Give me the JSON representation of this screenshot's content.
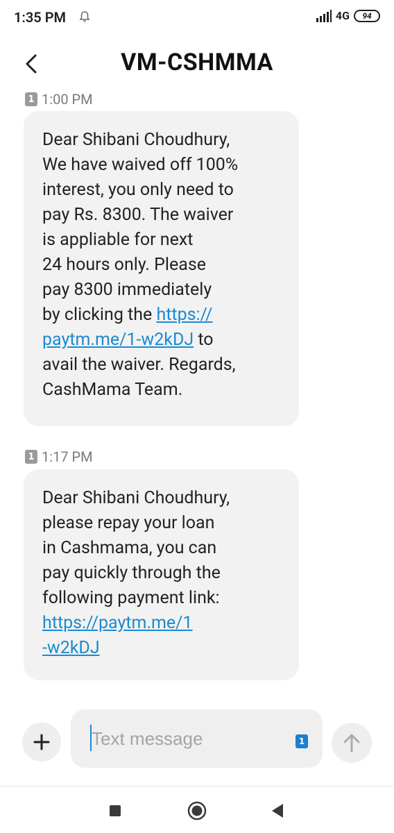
{
  "status_bar": {
    "time": "1:35 PM",
    "network": "4G",
    "battery": "94",
    "icons": [
      "bell-icon",
      "signal-icon",
      "battery-icon"
    ]
  },
  "header": {
    "title": "VM-CSHMMA",
    "back_icon": "chevron-left-icon"
  },
  "messages": [
    {
      "sim": "1",
      "time": "1:00 PM",
      "lines": [
        "Dear Shibani Choudhury,",
        "We have waived off 100%",
        "interest, you only need to",
        "pay Rs. 8300. The waiver",
        "is appliable for next",
        "24 hours only. Please",
        "pay 8300 immediately"
      ],
      "link_line_prefix": "by clicking the ",
      "link_part1": "https://",
      "link_part2": "paytm.me/1-w2kDJ",
      "after_link": " to",
      "tail_lines": [
        "avail the waiver. Regards,",
        "CashMama Team."
      ]
    },
    {
      "sim": "1",
      "time": "1:17 PM",
      "lines": [
        "Dear Shibani Choudhury,",
        "please repay your loan",
        "in Cashmama, you can",
        "pay quickly through the",
        "following payment link:"
      ],
      "link_part1": "https://paytm.me/1",
      "link_part2": "-w2kDJ"
    }
  ],
  "composer": {
    "placeholder": "Text message",
    "sim_label": "1",
    "add_icon": "plus-icon",
    "send_icon": "arrow-up-icon"
  },
  "nav": {
    "icons": [
      "square-recents-icon",
      "circle-home-icon",
      "triangle-back-icon"
    ]
  },
  "colors": {
    "link": "#1a8ad1",
    "bubble": "#f2f2f2",
    "sim_badge": "#9a9a9a",
    "sim_select": "#1a7fd0"
  }
}
